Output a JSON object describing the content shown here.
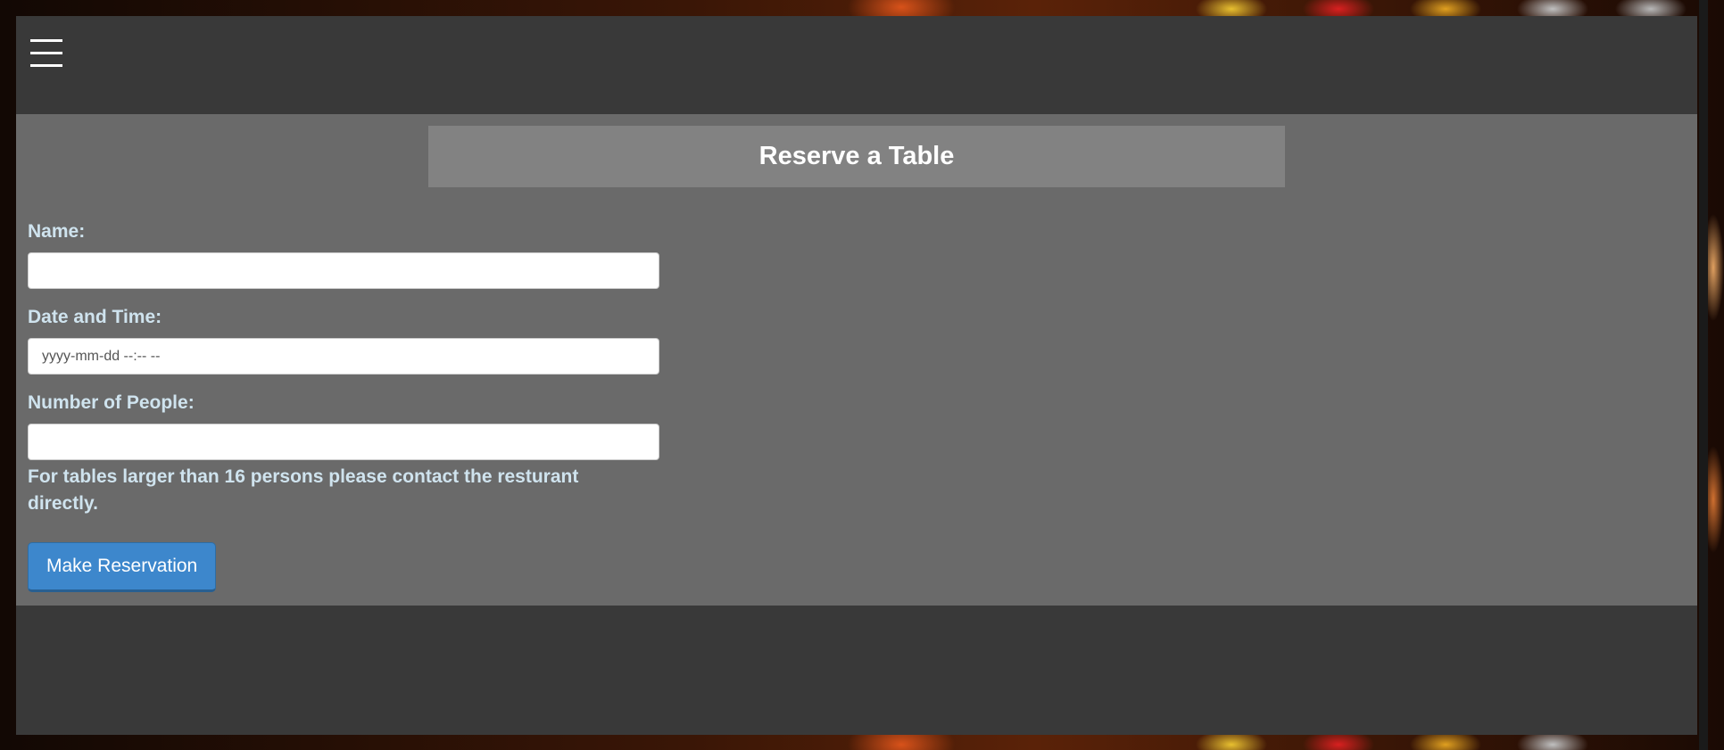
{
  "nav": {
    "menu_icon": "hamburger-menu-icon"
  },
  "reservation": {
    "title": "Reserve a Table",
    "name_label": "Name:",
    "name_value": "",
    "datetime_label": "Date and Time:",
    "datetime_placeholder": "yyyy-mm-dd --:-- --",
    "people_label": "Number of People:",
    "people_value": "",
    "note": "For tables larger than 16 persons please contact the resturant directly.",
    "submit_label": "Make Reservation"
  },
  "colors": {
    "header_bg": "#393939",
    "content_bg": "#6a6a6a",
    "title_bg": "#828282",
    "label_text": "#cfe3ee",
    "button_bg": "#3d87cc"
  }
}
